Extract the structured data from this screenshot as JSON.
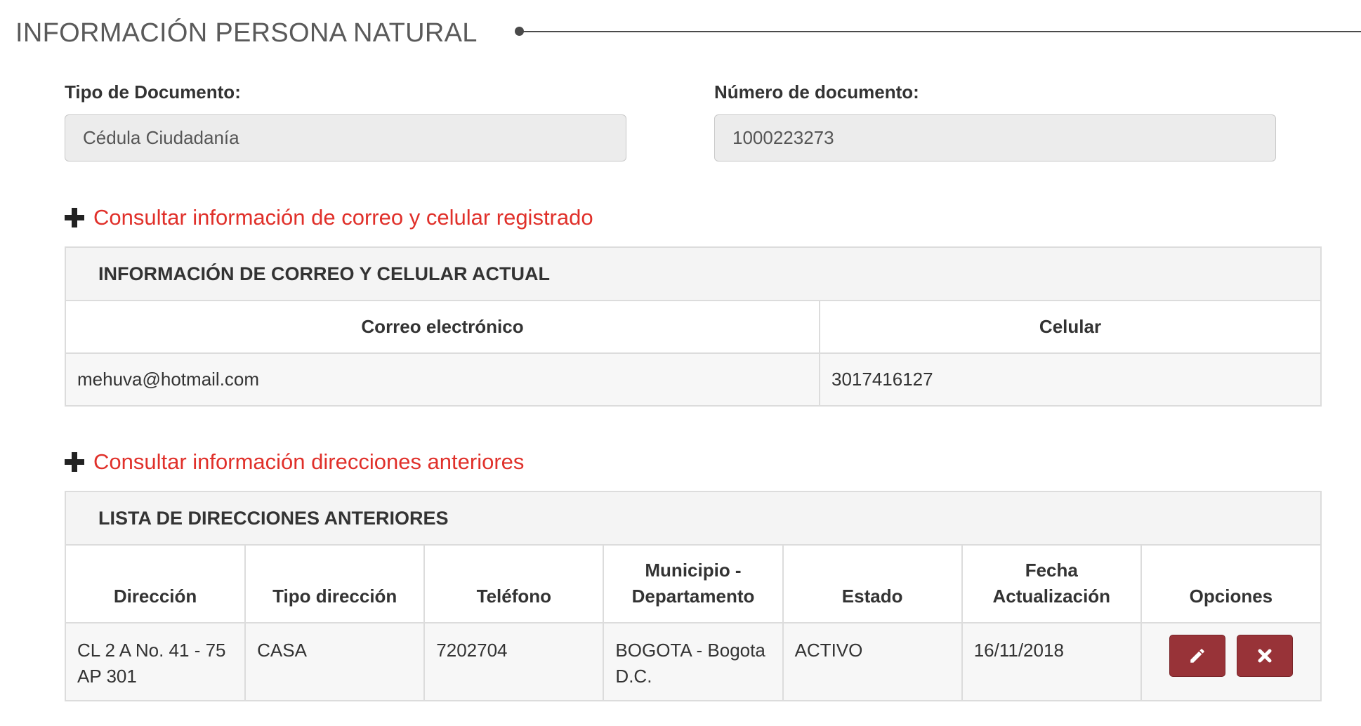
{
  "section": {
    "title": "INFORMACIÓN PERSONA NATURAL"
  },
  "form": {
    "doc_type_label": "Tipo de Documento:",
    "doc_type_value": "Cédula Ciudadanía",
    "doc_number_label": "Número de documento:",
    "doc_number_value": "1000223273"
  },
  "contact": {
    "toggle_label": "Consultar información de correo y celular registrado",
    "panel_title": "INFORMACIÓN DE CORREO Y CELULAR ACTUAL",
    "columns": [
      "Correo electrónico",
      "Celular"
    ],
    "rows": [
      {
        "email": "mehuva@hotmail.com",
        "phone": "3017416127"
      }
    ]
  },
  "addresses": {
    "toggle_label": "Consultar información direcciones anteriores",
    "panel_title": "LISTA DE DIRECCIONES ANTERIORES",
    "columns": {
      "direccion": "Dirección",
      "tipo": "Tipo dirección",
      "telefono": "Teléfono",
      "municipio_1": "Municipio -",
      "municipio_2": "Departamento",
      "estado": "Estado",
      "fecha_1": "Fecha",
      "fecha_2": "Actualización",
      "opciones": "Opciones"
    },
    "rows": [
      {
        "direccion_1": "CL 2 A No. 41 - 75",
        "direccion_2": "AP 301",
        "tipo": "CASA",
        "telefono": "7202704",
        "municipio_1": "BOGOTA - Bogota",
        "municipio_2": "D.C.",
        "estado": "ACTIVO",
        "fecha": "16/11/2018"
      }
    ]
  },
  "icons": {
    "toggle": "plus-icon",
    "edit": "pencil-icon",
    "delete": "close-icon"
  },
  "colors": {
    "link": "#e0302a",
    "action_button": "#983338",
    "title": "#5a5a5a"
  }
}
